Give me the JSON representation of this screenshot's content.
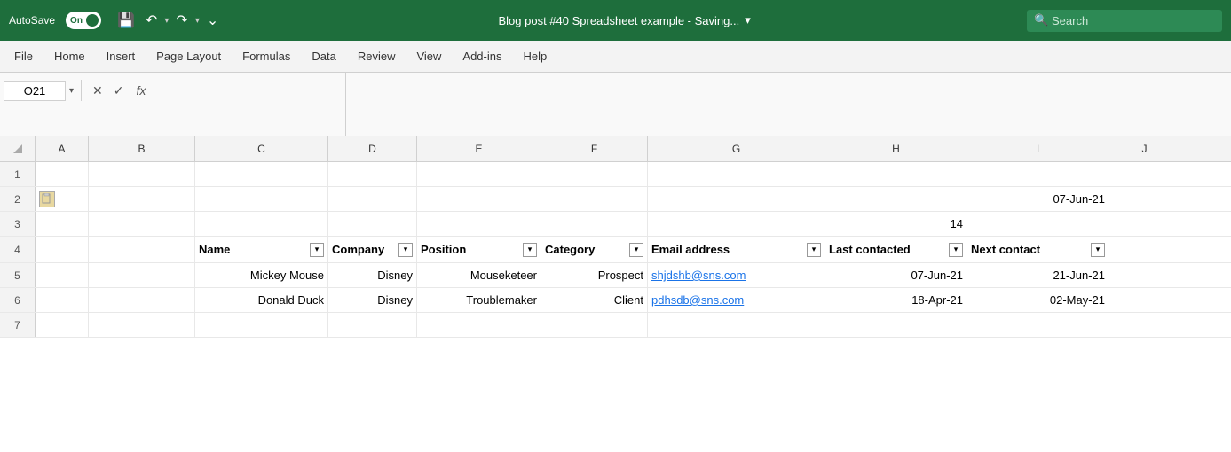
{
  "titlebar": {
    "autosave_label": "AutoSave",
    "autosave_state": "On",
    "title": "Blog post #40 Spreadsheet example  -  Saving...",
    "title_dropdown": "▾",
    "search_placeholder": "Search"
  },
  "menubar": {
    "items": [
      "File",
      "Home",
      "Insert",
      "Page Layout",
      "Formulas",
      "Data",
      "Review",
      "View",
      "Add-ins",
      "Help"
    ]
  },
  "formulabar": {
    "cell_ref": "O21",
    "cancel_icon": "✕",
    "confirm_icon": "✓",
    "fx_label": "fx"
  },
  "columns": {
    "headers": [
      "",
      "A",
      "B",
      "C",
      "D",
      "E",
      "F",
      "G",
      "H",
      "I",
      "J"
    ]
  },
  "rows": {
    "row1": {
      "num": "1",
      "cells": [
        "",
        "",
        "",
        "",
        "",
        "",
        "",
        "",
        "",
        ""
      ]
    },
    "row2": {
      "num": "2",
      "cells": [
        "",
        "",
        "",
        "",
        "",
        "",
        "",
        "",
        "",
        "07-Jun-21",
        ""
      ]
    },
    "row3": {
      "num": "3",
      "cells": [
        "",
        "",
        "",
        "",
        "",
        "",
        "",
        "",
        "14",
        "",
        ""
      ]
    },
    "row4": {
      "num": "4",
      "cells": [
        {
          "text": "",
          "filter": false
        },
        {
          "text": "",
          "filter": false
        },
        {
          "text": "Name",
          "filter": true
        },
        {
          "text": "Company",
          "filter": true
        },
        {
          "text": "Position",
          "filter": true
        },
        {
          "text": "Category",
          "filter": true
        },
        {
          "text": "Email address",
          "filter": true
        },
        {
          "text": "Last contacted",
          "filter": true
        },
        {
          "text": "Next contact",
          "filter": true
        },
        {
          "text": "",
          "filter": false
        }
      ]
    },
    "row5": {
      "num": "5",
      "cells": [
        "",
        "",
        "Mickey Mouse",
        "Disney",
        "Mouseketeer",
        "Prospect",
        "shjdshb@sns.com",
        "07-Jun-21",
        "21-Jun-21",
        ""
      ]
    },
    "row6": {
      "num": "6",
      "cells": [
        "",
        "",
        "Donald Duck",
        "Disney",
        "Troublemaker",
        "Client",
        "pdhsdb@sns.com",
        "18-Apr-21",
        "02-May-21",
        ""
      ]
    },
    "row7": {
      "num": "7",
      "cells": [
        "",
        "",
        "",
        "",
        "",
        "",
        "",
        "",
        "",
        ""
      ]
    }
  },
  "colors": {
    "excel_green": "#1e6e3c",
    "link_blue": "#1a73e8"
  }
}
